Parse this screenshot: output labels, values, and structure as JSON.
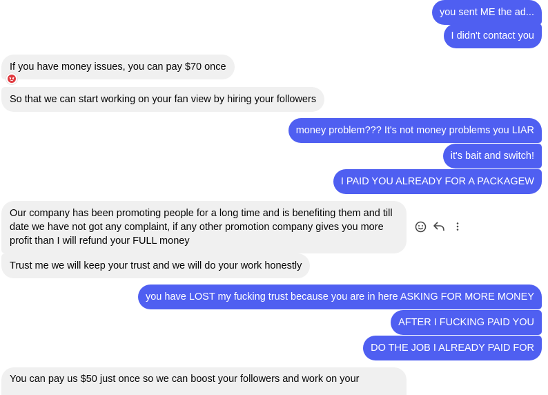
{
  "messages": [
    {
      "side": "out",
      "text": "you sent ME the ad..."
    },
    {
      "side": "out",
      "text": "I didn't contact you"
    },
    {
      "side": "in",
      "text": "If you have money issues, you can pay $70 once"
    },
    {
      "side": "in",
      "text": "So that we can start working on your fan view by hiring your followers"
    },
    {
      "side": "out",
      "text": "money problem??? It's not money problems you LIAR"
    },
    {
      "side": "out",
      "text": "it's bait and switch!"
    },
    {
      "side": "out",
      "text": "I PAID YOU ALREADY FOR A PACKAGEW"
    },
    {
      "side": "in",
      "text": "Our company has been promoting people for a long time and is benefiting them and till date we have not got any complaint, if any other promotion company gives you more profit than  I will refund your FULL money"
    },
    {
      "side": "in",
      "text": "Trust me we will keep your trust and we will do your work honestly"
    },
    {
      "side": "out",
      "text": "you have LOST my fucking trust because you are in here ASKING FOR MORE MONEY"
    },
    {
      "side": "out",
      "text": "AFTER I FUCKING PAID YOU"
    },
    {
      "side": "out",
      "text": "DO THE JOB I ALREADY PAID FOR"
    },
    {
      "side": "in",
      "text": "You can pay us $50 just once so we can boost your followers and work on your"
    }
  ],
  "reaction": {
    "icon": "angry-face-icon",
    "color": "#e0393e"
  },
  "hover_actions": [
    {
      "icon": "smiley-react-icon",
      "label": "React"
    },
    {
      "icon": "reply-arrow-icon",
      "label": "Reply"
    },
    {
      "icon": "more-vertical-icon",
      "label": "More"
    }
  ],
  "colors": {
    "outgoing_bubble": "#4f5ff1",
    "incoming_bubble": "#f0f0f0",
    "incoming_text": "#050505",
    "outgoing_text": "#ffffff"
  }
}
